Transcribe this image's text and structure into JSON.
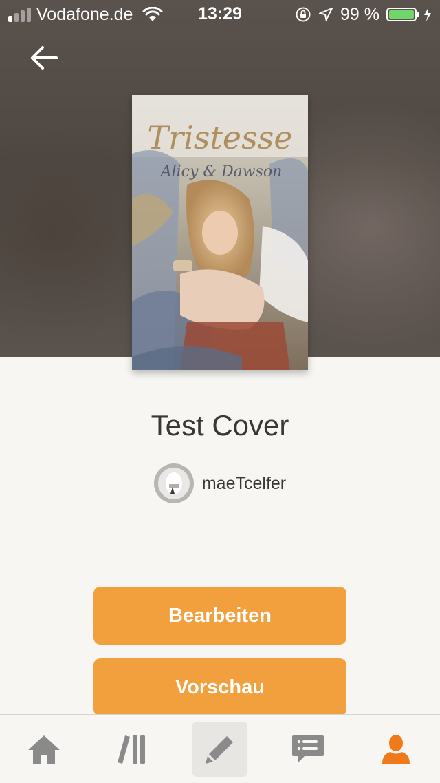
{
  "status_bar": {
    "carrier": "Vodafone.de",
    "time": "13:29",
    "battery_percent": "99 %",
    "signal_bars_filled": 1,
    "signal_bars_total": 4,
    "battery_level": 0.99,
    "battery_color": "#6fd66a"
  },
  "cover": {
    "title_text": "Tristesse",
    "subtitle_text": "Alicy & Dawson"
  },
  "story": {
    "title": "Test Cover",
    "author": "maeTcelfer"
  },
  "buttons": {
    "edit_label": "Bearbeiten",
    "preview_label": "Vorschau"
  },
  "tab_bar": {
    "items": [
      {
        "icon": "home-icon",
        "active": false
      },
      {
        "icon": "library-icon",
        "active": false
      },
      {
        "icon": "pencil-icon",
        "active": true
      },
      {
        "icon": "messages-icon",
        "active": false
      },
      {
        "icon": "profile-icon",
        "active": false,
        "color": "#f07a1a"
      }
    ]
  },
  "colors": {
    "accent": "#f2a03d",
    "background": "#f7f6f2",
    "text": "#3a3835",
    "icon_gray": "#8a8a8a"
  }
}
